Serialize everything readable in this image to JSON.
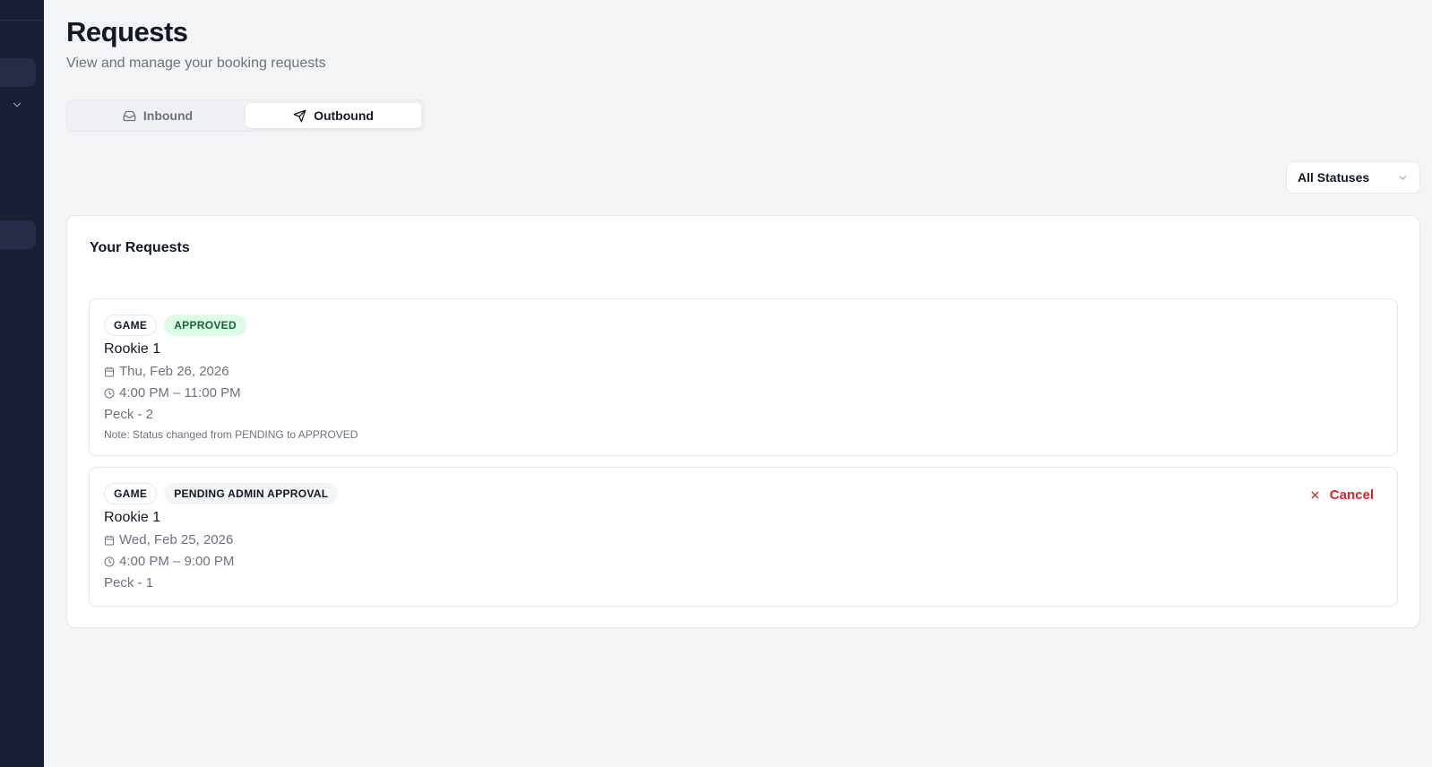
{
  "header": {
    "title": "Requests",
    "subtitle": "View and manage your booking requests"
  },
  "tabs": [
    {
      "label": "Inbound",
      "icon": "inbox-icon",
      "active": false
    },
    {
      "label": "Outbound",
      "icon": "send-icon",
      "active": true
    }
  ],
  "filter": {
    "selected": "All Statuses"
  },
  "requests_card": {
    "title": "Your Requests",
    "items": [
      {
        "type_badge": "GAME",
        "status_badge": "APPROVED",
        "name": "Rookie 1",
        "date": "Thu, Feb 26, 2026",
        "time": "4:00 PM – 11:00 PM",
        "location": "Peck - 2",
        "note": "Note: Status changed from PENDING to APPROVED"
      },
      {
        "type_badge": "GAME",
        "status_badge": "PENDING ADMIN APPROVAL",
        "name": "Rookie 1",
        "date": "Wed, Feb 25, 2026",
        "time": "4:00 PM – 9:00 PM",
        "location": "Peck - 1",
        "cancel_label": "Cancel"
      }
    ]
  },
  "colors": {
    "sidebar": "#1a1f36",
    "background": "#f3f4f6",
    "approved_bg": "#dcfce7",
    "approved_text": "#166534",
    "danger": "#dc2626"
  }
}
